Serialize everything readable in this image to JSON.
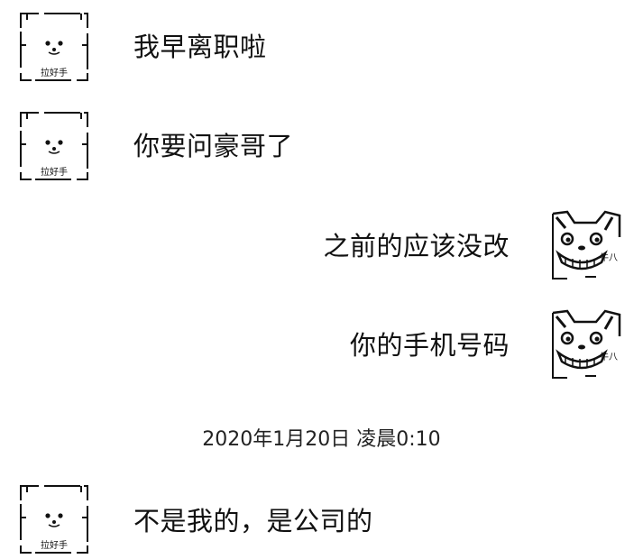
{
  "chat": {
    "messages": [
      {
        "side": "left",
        "text": "我早离职啦"
      },
      {
        "side": "left",
        "text": "你要问豪哥了"
      },
      {
        "side": "right",
        "text": "之前的应该没改"
      },
      {
        "side": "right",
        "text": "你的手机号码"
      },
      {
        "side": "left",
        "text": "不是我的，是公司的"
      }
    ],
    "timestamp": "2020年1月20日 凌晨0:10"
  },
  "avatars": {
    "left_icon": "panda-face-icon",
    "left_label": "拉好手",
    "right_icon": "shiba-dog-grin-icon",
    "right_label": "牛八"
  }
}
